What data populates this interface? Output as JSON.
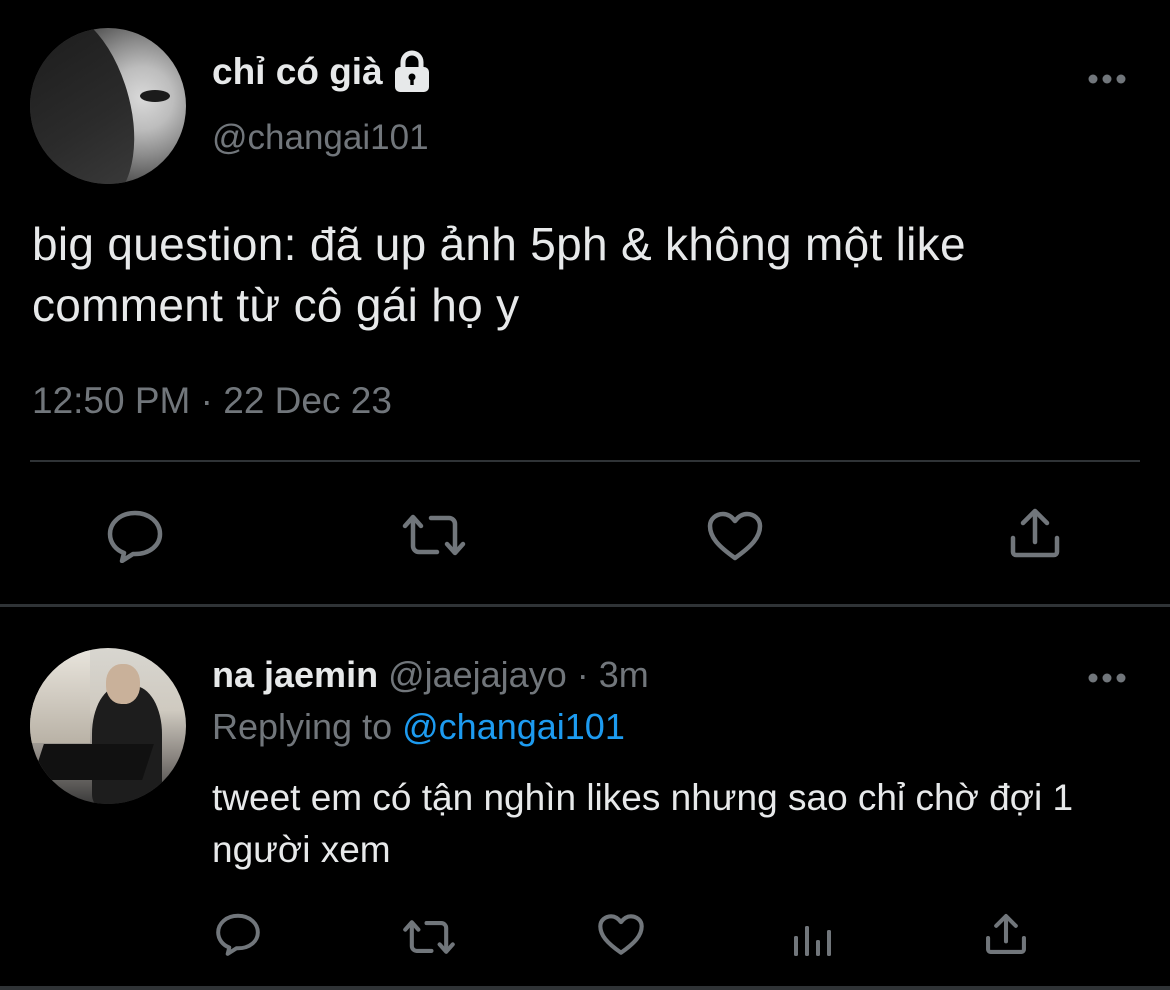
{
  "main_tweet": {
    "display_name": "chỉ có già",
    "handle": "@changai101",
    "text": "big question: đã up ảnh 5ph & không một like comment từ cô gái họ y",
    "timestamp": "12:50 PM · 22 Dec 23",
    "icons": {
      "protected": "lock-icon",
      "more": "more-horizontal-icon",
      "actions": [
        "reply-icon",
        "retweet-icon",
        "like-icon",
        "share-icon"
      ]
    }
  },
  "reply": {
    "display_name": "na jaemin",
    "meta": "@jaejajayo · 3m",
    "replying_label": "Replying to",
    "replying_handle": "@changai101",
    "text": "tweet em có tận nghìn likes nhưng sao chỉ chờ đợi 1 người xem",
    "icons": {
      "more": "more-horizontal-icon",
      "actions": [
        "reply-icon",
        "retweet-icon",
        "like-icon",
        "analytics-icon",
        "share-icon"
      ]
    }
  },
  "colors": {
    "background": "#000000",
    "primary_text": "#e7e9ea",
    "secondary_text": "#71767b",
    "link": "#1d9bf0",
    "divider": "#2f3336"
  }
}
